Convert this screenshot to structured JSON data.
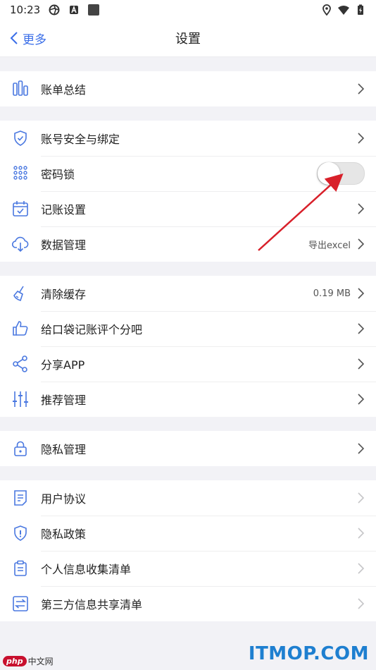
{
  "status_bar": {
    "time": "10:23"
  },
  "nav": {
    "back_label": "更多",
    "title": "设置"
  },
  "groups": [
    [
      {
        "icon": "bar-chart-icon",
        "label": "账单总结",
        "value": "",
        "control": "chevron"
      }
    ],
    [
      {
        "icon": "shield-check-icon",
        "label": "账号安全与绑定",
        "value": "",
        "control": "chevron"
      },
      {
        "icon": "keypad-icon",
        "label": "密码锁",
        "value": "",
        "control": "toggle",
        "toggle_on": false
      },
      {
        "icon": "calendar-check-icon",
        "label": "记账设置",
        "value": "",
        "control": "chevron"
      },
      {
        "icon": "cloud-download-icon",
        "label": "数据管理",
        "value": "导出excel",
        "control": "chevron"
      }
    ],
    [
      {
        "icon": "broom-icon",
        "label": "清除缓存",
        "value": "0.19 MB",
        "control": "chevron"
      },
      {
        "icon": "thumbs-up-icon",
        "label": "给口袋记账评个分吧",
        "value": "",
        "control": "chevron"
      },
      {
        "icon": "share-icon",
        "label": "分享APP",
        "value": "",
        "control": "chevron"
      },
      {
        "icon": "sliders-icon",
        "label": "推荐管理",
        "value": "",
        "control": "chevron"
      }
    ],
    [
      {
        "icon": "lock-icon",
        "label": "隐私管理",
        "value": "",
        "control": "chevron"
      }
    ],
    [
      {
        "icon": "document-icon",
        "label": "用户协议",
        "value": "",
        "control": "chevron-light"
      },
      {
        "icon": "shield-info-icon",
        "label": "隐私政策",
        "value": "",
        "control": "chevron-light"
      },
      {
        "icon": "clipboard-icon",
        "label": "个人信息收集清单",
        "value": "",
        "control": "chevron-light"
      },
      {
        "icon": "swap-icon",
        "label": "第三方信息共享清单",
        "value": "",
        "control": "chevron-light"
      }
    ]
  ],
  "watermarks": {
    "left_badge": "php",
    "left_text": "中文网",
    "right_text": "ITMOP.COM"
  },
  "colors": {
    "accent": "#3a6ee8",
    "icon": "#4a78e0",
    "annotation_arrow": "#d8202a"
  }
}
